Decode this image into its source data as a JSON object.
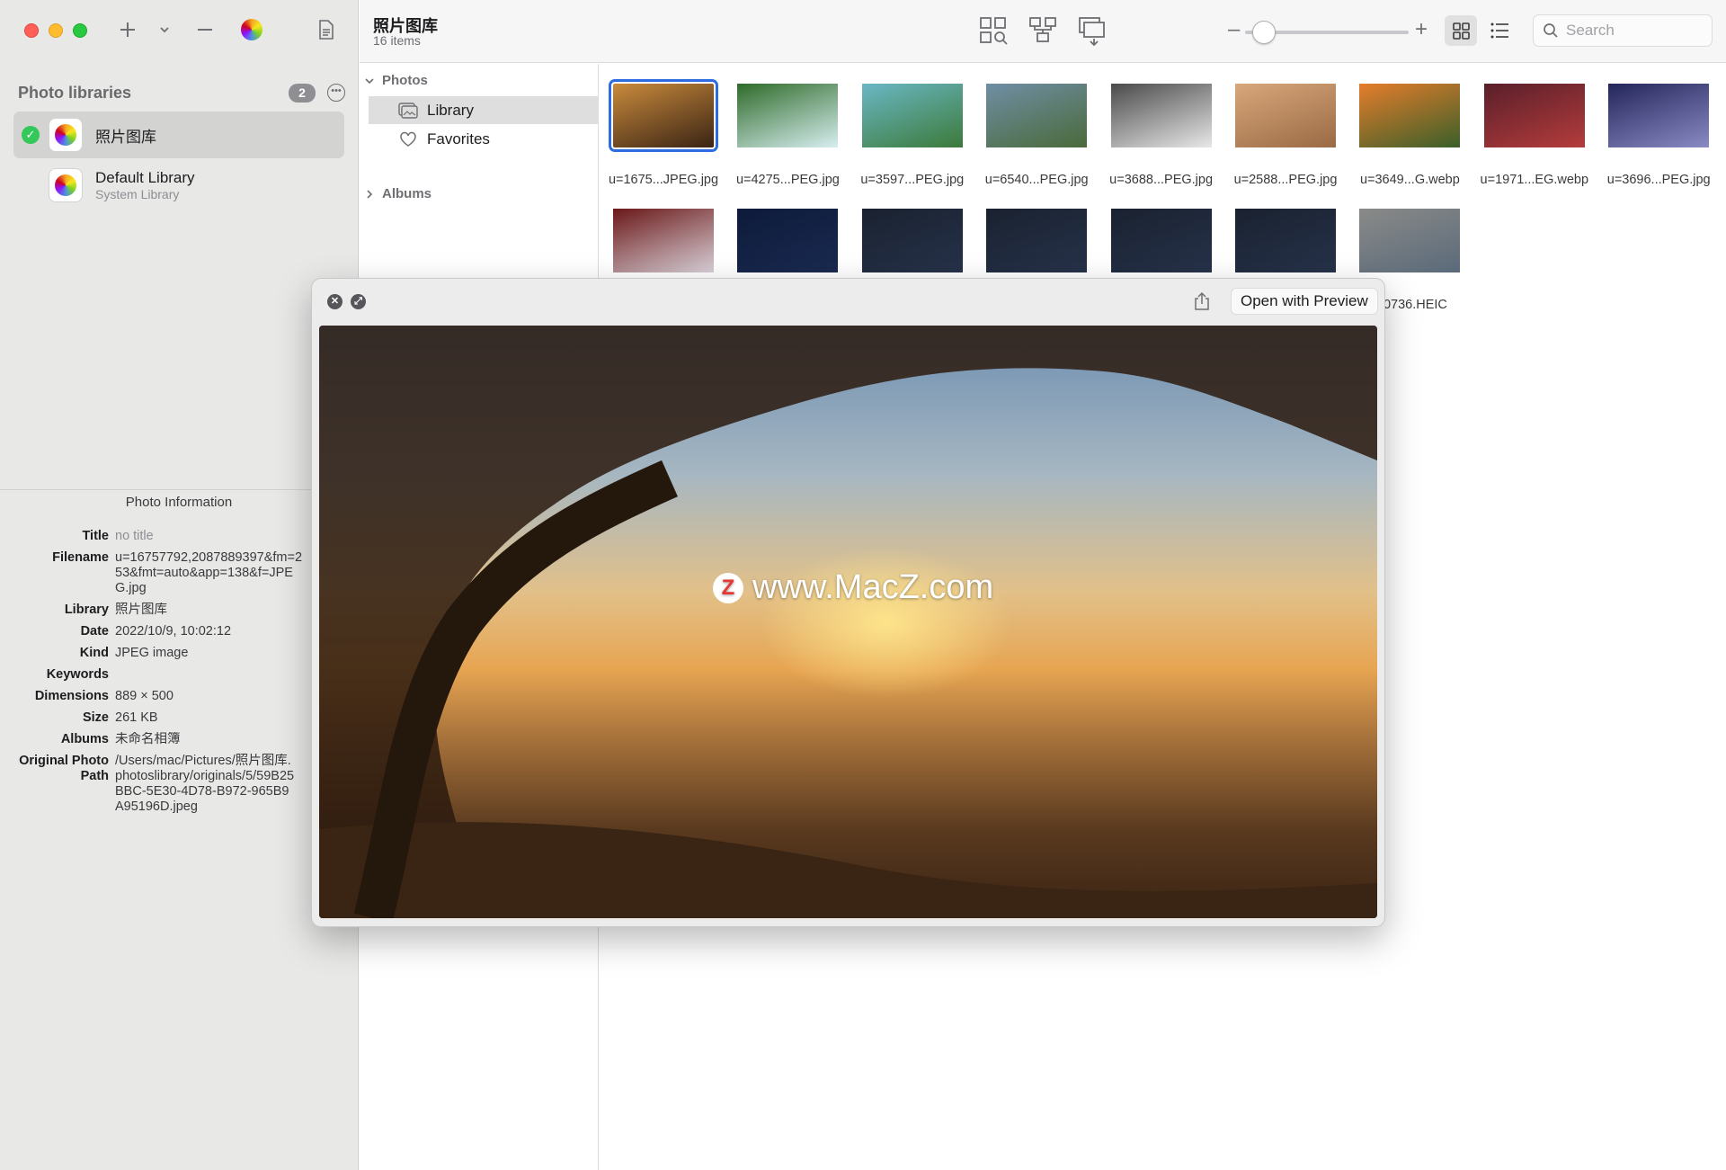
{
  "sidebar": {
    "heading": "Photo libraries",
    "count": "2",
    "libraries": [
      {
        "title": "照片图库",
        "subtitle": "",
        "selected": true
      },
      {
        "title": "Default Library",
        "subtitle": "System Library",
        "selected": false
      }
    ],
    "info": {
      "heading": "Photo Information",
      "rows": [
        {
          "label": "Title",
          "value": "no title"
        },
        {
          "label": "Filename",
          "value": "u=16757792,2087889397&fm=253&fmt=auto&app=138&f=JPEG.jpg"
        },
        {
          "label": "Library",
          "value": "照片图库"
        },
        {
          "label": "Date",
          "value": "2022/10/9, 10:02:12"
        },
        {
          "label": "Kind",
          "value": "JPEG image"
        },
        {
          "label": "Keywords",
          "value": ""
        },
        {
          "label": "Dimensions",
          "value": "889 × 500"
        },
        {
          "label": "Size",
          "value": "261 KB"
        },
        {
          "label": "Albums",
          "value": "未命名相簿"
        },
        {
          "label": "Original Photo Path",
          "value": "/Users/mac/Pictures/照片图库.photoslibrary/originals/5/59B25BBC-5E30-4D78-B972-965B9A95196D.jpeg"
        }
      ]
    }
  },
  "header": {
    "title": "照片图库",
    "subtitle": "16 items",
    "search_placeholder": "Search"
  },
  "nav": {
    "photos_section": "Photos",
    "items": [
      "Library",
      "Favorites"
    ],
    "albums_section": "Albums"
  },
  "grid": {
    "row1": [
      {
        "name": "u=1675...JPEG.jpg",
        "colors": [
          "#c98a3c",
          "#3a2414"
        ]
      },
      {
        "name": "u=4275...PEG.jpg",
        "colors": [
          "#2f6b2a",
          "#d7eef0"
        ]
      },
      {
        "name": "u=3597...PEG.jpg",
        "colors": [
          "#6ab7c4",
          "#3c7a3a"
        ]
      },
      {
        "name": "u=6540...PEG.jpg",
        "colors": [
          "#6f8ea5",
          "#4a6a3a"
        ]
      },
      {
        "name": "u=3688...PEG.jpg",
        "colors": [
          "#4a4a4a",
          "#e8e8e8"
        ]
      },
      {
        "name": "u=2588...PEG.jpg",
        "colors": [
          "#d8a77a",
          "#9a6a45"
        ]
      },
      {
        "name": "u=3649...G.webp",
        "colors": [
          "#e57d2b",
          "#3a5f2a"
        ]
      },
      {
        "name": "u=1971...EG.webp",
        "colors": [
          "#5a1f2a",
          "#b43c3c"
        ]
      },
      {
        "name": "u=3696...PEG.jpg",
        "colors": [
          "#23265a",
          "#8a8ac4"
        ]
      }
    ],
    "row2": [
      {
        "name": "",
        "colors": [
          "#6a1818",
          "#d8d0d8"
        ]
      },
      {
        "name": "",
        "colors": [
          "#0d1a3a",
          "#1a2a50"
        ]
      },
      {
        "name": "",
        "colors": [
          "#1a2230",
          "#26324a"
        ]
      },
      {
        "name": "",
        "colors": [
          "#1a2230",
          "#26324a"
        ]
      },
      {
        "name": "",
        "colors": [
          "#1a2230",
          "#26324a"
        ]
      },
      {
        "name": "",
        "colors": [
          "#1a2230",
          "#26324a"
        ]
      },
      {
        "name": "...0736.HEIC",
        "colors": [
          "#8a8a88",
          "#5a6a7a"
        ]
      }
    ]
  },
  "quicklook": {
    "open_label": "Open with Preview",
    "watermark": "www.MacZ.com",
    "watermark_logo": "Z"
  }
}
